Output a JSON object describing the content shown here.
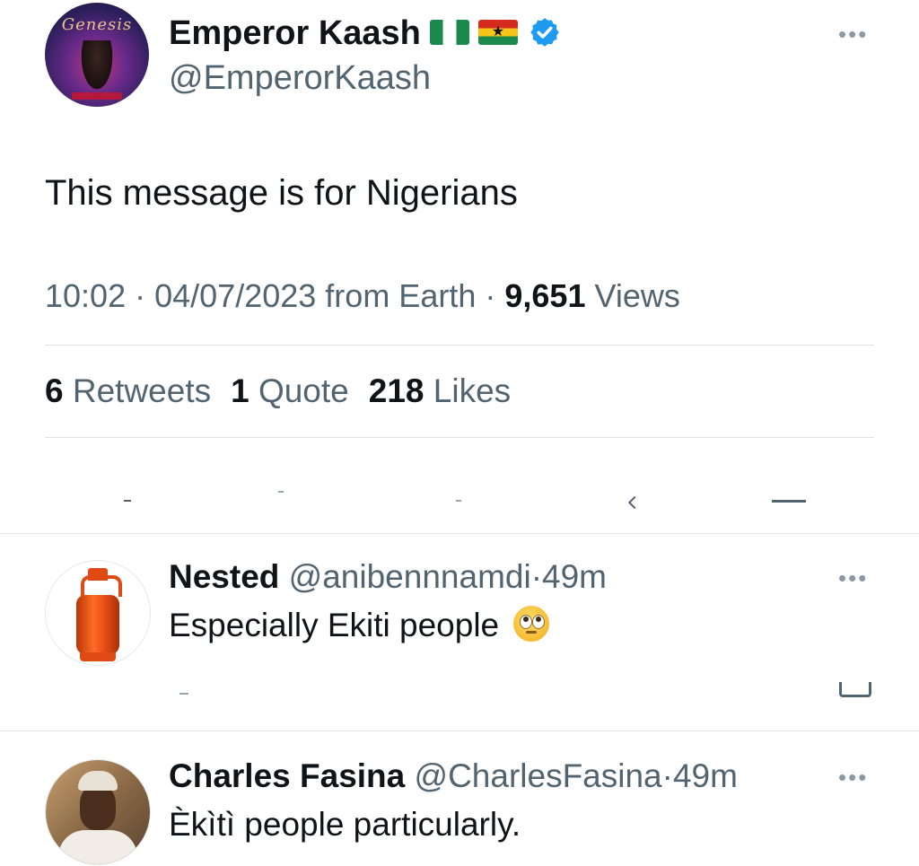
{
  "tweet": {
    "avatar_caption": "Genesis",
    "display_name": "Emperor Kaash",
    "flags": [
      "nigeria-flag-icon",
      "ghana-flag-icon"
    ],
    "verified_icon": "verified-badge-icon",
    "handle": "@EmperorKaash",
    "text": "This message is for Nigerians",
    "time": "10:02",
    "date": "04/07/2023 from Earth",
    "views_count": "9,651",
    "views_label": "Views",
    "retweets_count": "6",
    "retweets_label": "Retweets",
    "quotes_count": "1",
    "quotes_label": "Quote",
    "likes_count": "218",
    "likes_label": "Likes"
  },
  "replies": [
    {
      "name": "Nested",
      "handle": "@anibennnamdi",
      "age": "49m",
      "text": "Especially Ekiti people",
      "emoji": "face-with-rolling-eyes-icon"
    },
    {
      "name": "Charles Fasina",
      "handle": "@CharlesFasina",
      "age": "49m",
      "text": "Èkìtì people particularly."
    }
  ],
  "more_label": "•••",
  "separator": "·",
  "colors": {
    "text": "#0f1419",
    "muted": "#536471",
    "verified": "#1d9bf0",
    "divider": "#dfe3e6"
  }
}
